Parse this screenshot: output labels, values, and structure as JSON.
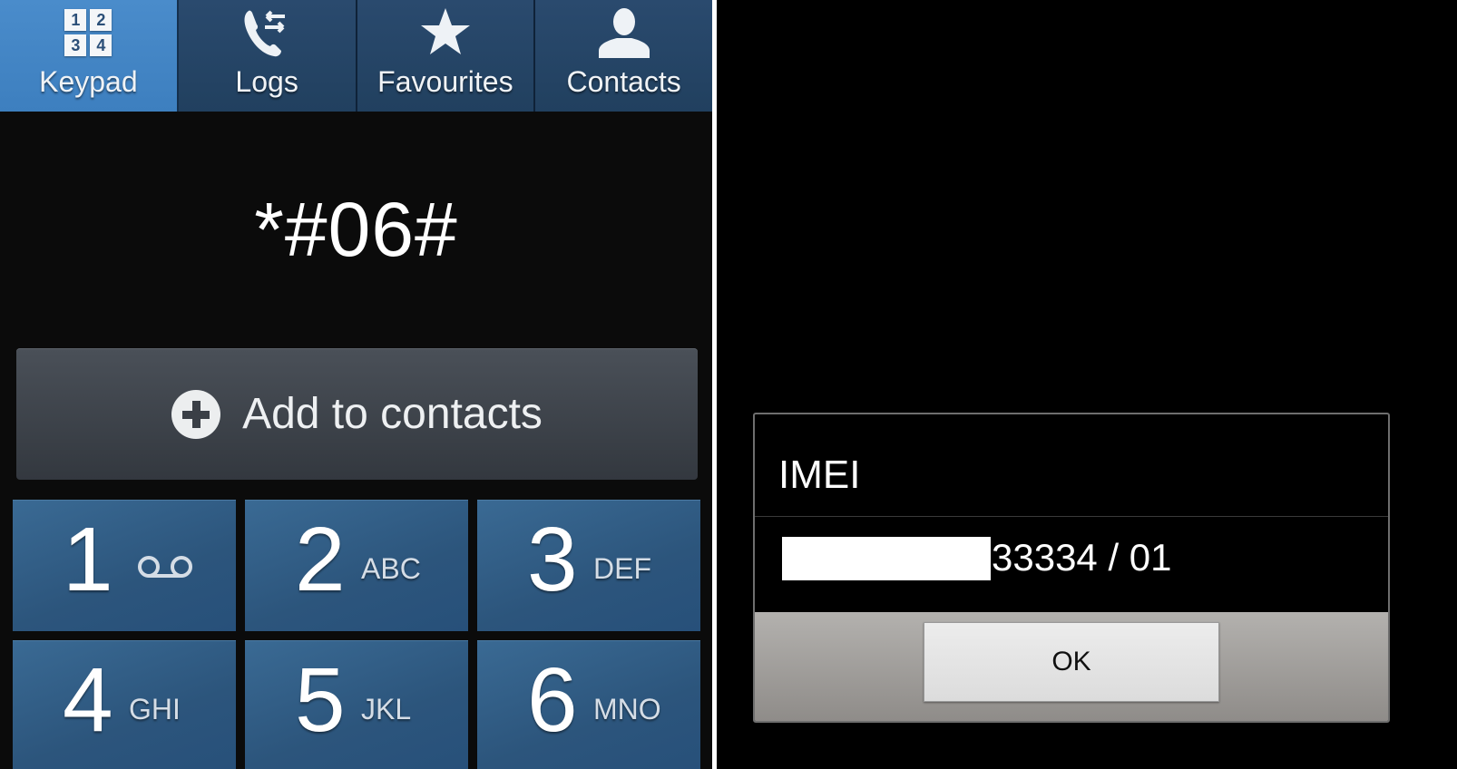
{
  "dialer": {
    "tabs": [
      {
        "label": "Keypad",
        "icon": "keypad-icon",
        "active": true,
        "icon_digits": [
          "1",
          "2",
          "3",
          "4"
        ]
      },
      {
        "label": "Logs",
        "icon": "call-log-icon",
        "active": false
      },
      {
        "label": "Favourites",
        "icon": "star-icon",
        "active": false
      },
      {
        "label": "Contacts",
        "icon": "person-icon",
        "active": false
      }
    ],
    "dialed_number": "*#06#",
    "add_to_contacts_label": "Add to contacts",
    "keys": [
      {
        "digit": "1",
        "letters": "",
        "icon": "voicemail-icon"
      },
      {
        "digit": "2",
        "letters": "ABC"
      },
      {
        "digit": "3",
        "letters": "DEF"
      },
      {
        "digit": "4",
        "letters": "GHI"
      },
      {
        "digit": "5",
        "letters": "JKL"
      },
      {
        "digit": "6",
        "letters": "MNO"
      }
    ]
  },
  "dialog": {
    "title": "IMEI",
    "value_visible": "33334 / 01",
    "ok_label": "OK"
  },
  "colors": {
    "tab_active": "#3d7fbf",
    "tab_inactive": "#23425f",
    "key_bg": "#2c557c",
    "button_gray": "#3d4249"
  }
}
